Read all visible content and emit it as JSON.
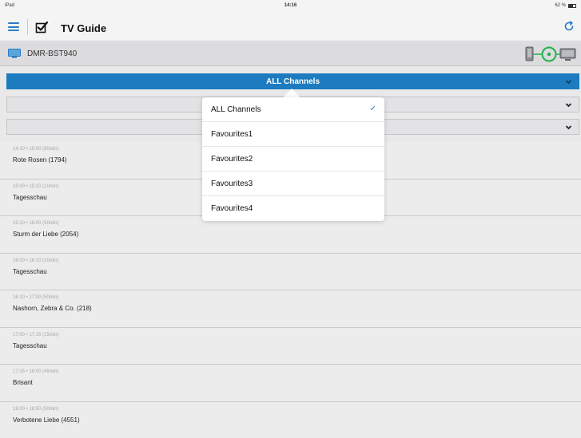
{
  "status_bar": {
    "device": "iPad",
    "time": "14:16",
    "battery": "62 %",
    "battery_level": 0.62
  },
  "nav": {
    "title": "TV Guide",
    "menu_icon": "hamburger-menu-icon",
    "app_icon": "checkbox-icon",
    "refresh_icon": "refresh-icon"
  },
  "device": {
    "name": "DMR-BST940",
    "icon": "tv-icon",
    "status_icon": "remote-connect-icon"
  },
  "filters": {
    "channel_group": "ALL Channels",
    "second": "",
    "third": ""
  },
  "programmes": [
    {
      "time": "14:10 • 15:00 (50min)",
      "title": "Rote Rosen (1794)"
    },
    {
      "time": "15:00 • 15:10 (10min)",
      "title": "Tagesschau"
    },
    {
      "time": "15:10 • 16:00 (50min)",
      "title": "Sturm der Liebe (2054)"
    },
    {
      "time": "16:00 • 16:10 (10min)",
      "title": "Tagesschau"
    },
    {
      "time": "16:10 • 17:00 (50min)",
      "title": "Nashorn, Zebra & Co. (218)"
    },
    {
      "time": "17:00 • 17:15 (15min)",
      "title": "Tagesschau"
    },
    {
      "time": "17:15 • 18:00 (45min)",
      "title": "Brisant"
    },
    {
      "time": "18:00 • 18:50 (50min)",
      "title": "Verbotene Liebe (4551)"
    }
  ],
  "popover": {
    "items": [
      {
        "label": "ALL Channels",
        "check": "✓"
      },
      {
        "label": "Favourites1",
        "check": ""
      },
      {
        "label": "Favourites2",
        "check": ""
      },
      {
        "label": "Favourites3",
        "check": ""
      },
      {
        "label": "Favourites4",
        "check": ""
      }
    ]
  },
  "colors": {
    "accent": "#1d7cbf",
    "connect_green": "#20b24a"
  }
}
